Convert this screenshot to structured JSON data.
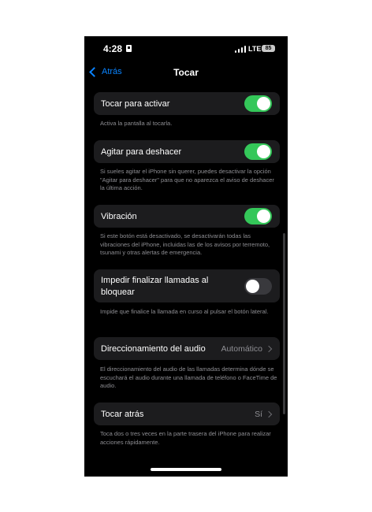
{
  "status_bar": {
    "time": "4:28",
    "network": "LTE",
    "battery": "85",
    "lock_icon": "lock-icon",
    "signal_icon": "signal-bars-icon"
  },
  "nav": {
    "back_label": "Atrás",
    "title": "Tocar",
    "back_icon": "chevron-left-icon"
  },
  "settings": [
    {
      "label": "Tocar para activar",
      "control": "toggle",
      "on": true,
      "footer": "Activa la pantalla al tocarla."
    },
    {
      "label": "Agitar para deshacer",
      "control": "toggle",
      "on": true,
      "footer": "Si sueles agitar el iPhone sin querer, puedes desactivar la opción \"Agitar para deshacer\" para que no aparezca el aviso de deshacer la última acción."
    },
    {
      "label": "Vibración",
      "control": "toggle",
      "on": true,
      "footer": "Si este botón está desactivado, se desactivarán todas las vibraciones del iPhone, incluidas las de los avisos por terremoto, tsunami y otras alertas de emergencia."
    },
    {
      "label": "Impedir finalizar llamadas al bloquear",
      "control": "toggle",
      "on": false,
      "footer": "Impide que finalice la llamada en curso al pulsar el botón lateral."
    },
    {
      "label": "Direccionamiento del audio",
      "control": "disclosure",
      "value": "Automático",
      "footer": "El direccionamiento del audio de las llamadas determina dónde se escuchará el audio durante una llamada de teléfono o FaceTime de audio."
    },
    {
      "label": "Tocar atrás",
      "control": "disclosure",
      "value": "Sí",
      "footer": "Toca dos o tres veces en la parte trasera del iPhone para realizar acciones rápidamente."
    }
  ],
  "colors": {
    "accent": "#0a84ff",
    "toggle_on": "#34c759",
    "toggle_off": "#39393d",
    "cell_bg": "#1c1c1e",
    "background": "#000000"
  }
}
